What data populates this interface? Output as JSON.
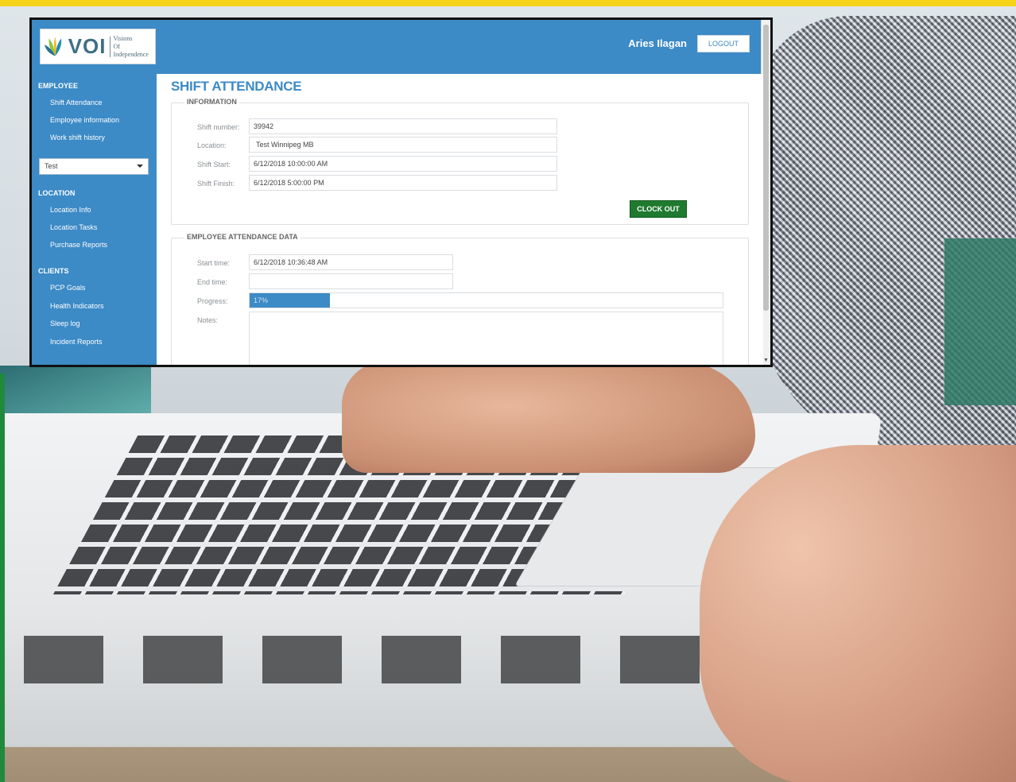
{
  "colors": {
    "brand_blue": "#3c8ac6",
    "clock_out_green": "#1f7a2f",
    "stripe_yellow": "#f6d21b"
  },
  "header": {
    "logo": {
      "wordmark": "VOI",
      "tagline_line1": "Visions",
      "tagline_line2": "Of Independence"
    },
    "user_name": "Aries Ilagan",
    "logout_label": "LOGOUT"
  },
  "sidebar": {
    "sections": [
      {
        "heading": "EMPLOYEE",
        "items": [
          "Shift Attendance",
          "Employee information",
          "Work shift history"
        ]
      },
      {
        "heading": "LOCATION",
        "items": [
          "Location Info",
          "Location Tasks",
          "Purchase Reports"
        ]
      },
      {
        "heading": "CLIENTS",
        "items": [
          "PCP Goals",
          "Health Indicators",
          "Sleep log",
          "Incident Reports"
        ]
      }
    ],
    "location_select": {
      "value": "Test"
    }
  },
  "main": {
    "title": "SHIFT ATTENDANCE",
    "information": {
      "legend": "INFORMATION",
      "fields": [
        {
          "label": "Shift number:",
          "value": "39942"
        },
        {
          "label": "Location:",
          "value": "Test Winnipeg MB"
        },
        {
          "label": "Shift Start:",
          "value": "6/12/2018 10:00:00 AM"
        },
        {
          "label": "Shift Finish:",
          "value": "6/12/2018 5:00:00 PM"
        }
      ],
      "clock_out_label": "CLOCK OUT"
    },
    "attendance": {
      "legend": "EMPLOYEE ATTENDANCE DATA",
      "start_time": {
        "label": "Start time:",
        "value": "6/12/2018 10:36:48 AM"
      },
      "end_time": {
        "label": "End time:",
        "value": ""
      },
      "progress": {
        "label": "Progress:",
        "percent": 17,
        "text": "17%"
      },
      "notes": {
        "label": "Notes:",
        "value": ""
      }
    }
  }
}
